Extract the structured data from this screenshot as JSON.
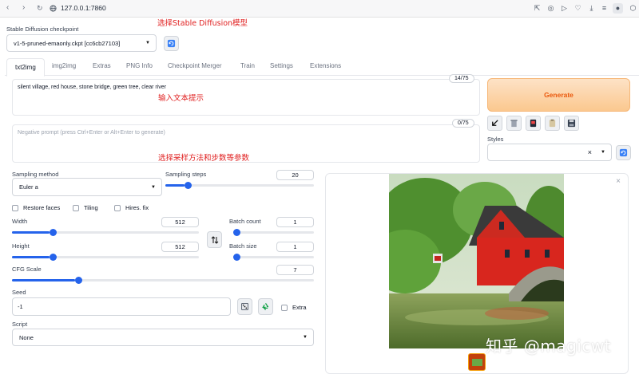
{
  "browser": {
    "url": "127.0.0.1:7860"
  },
  "annotations": {
    "model": "选择Stable Diffusion模型",
    "prompt": "输入文本提示",
    "sampling": "选择采样方法和步数等参数"
  },
  "checkpoint": {
    "label": "Stable Diffusion checkpoint",
    "value": "v1-5-pruned-emaonly.ckpt [cc6cb27103]"
  },
  "tabs": [
    "txt2img",
    "img2img",
    "Extras",
    "PNG Info",
    "Checkpoint Merger",
    "Train",
    "Settings",
    "Extensions"
  ],
  "prompt": {
    "text": "silent village, red house, stone bridge, green tree, clear river",
    "counter": "14/75"
  },
  "negative_prompt": {
    "placeholder": "Negative prompt (press Ctrl+Enter or Alt+Enter to generate)",
    "counter": "0/75"
  },
  "generate_label": "Generate",
  "styles": {
    "label": "Styles"
  },
  "sampling": {
    "method_label": "Sampling method",
    "method_value": "Euler a",
    "steps_label": "Sampling steps",
    "steps_value": "20",
    "steps_fraction": 0.13
  },
  "options": {
    "restore_faces": "Restore faces",
    "tiling": "Tiling",
    "hires_fix": "Hires. fix"
  },
  "width": {
    "label": "Width",
    "value": "512",
    "fraction": 0.2
  },
  "height": {
    "label": "Height",
    "value": "512",
    "fraction": 0.2
  },
  "batch_count": {
    "label": "Batch count",
    "value": "1",
    "fraction": 0.0
  },
  "batch_size": {
    "label": "Batch size",
    "value": "1",
    "fraction": 0.0
  },
  "cfg_scale": {
    "label": "CFG Scale",
    "value": "7",
    "fraction": 0.21
  },
  "seed": {
    "label": "Seed",
    "value": "-1",
    "extra_label": "Extra"
  },
  "script": {
    "label": "Script",
    "value": "None"
  },
  "watermark": "知乎 @magicwt",
  "colors": {
    "accent": "#2563eb",
    "generate_text": "#ea580c",
    "annotation": "#e02020"
  }
}
